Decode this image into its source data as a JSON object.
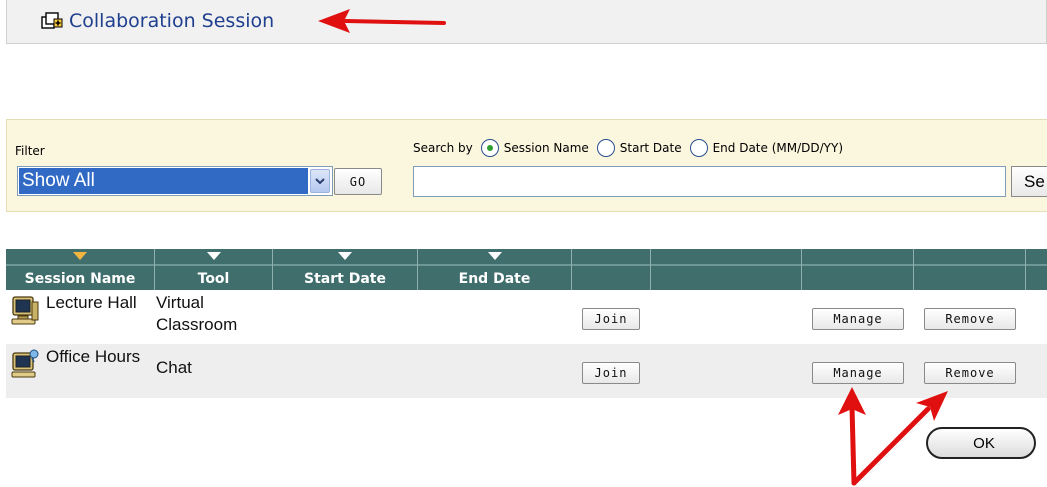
{
  "action_bar": {
    "link_label": "Collaboration Session",
    "icon": "add-session-icon"
  },
  "filter": {
    "label": "Filter",
    "selected": "Show All",
    "go_label": "GO"
  },
  "search": {
    "by_label": "Search by",
    "options": [
      {
        "label": "Session Name",
        "checked": true
      },
      {
        "label": "Start Date",
        "checked": false
      },
      {
        "label": "End Date (MM/DD/YY)",
        "checked": false
      }
    ],
    "value": "",
    "button_label": "Se"
  },
  "table": {
    "columns": [
      "Session Name",
      "Tool",
      "Start Date",
      "End Date",
      "",
      "",
      "",
      ""
    ],
    "rows": [
      {
        "icon": "computer-session-icon",
        "session_name": "Lecture Hall",
        "tool": "Virtual Classroom",
        "start_date": "",
        "end_date": "",
        "join_label": "Join",
        "manage_label": "Manage",
        "remove_label": "Remove"
      },
      {
        "icon": "computer-chat-icon",
        "session_name": "Office Hours",
        "tool": "Chat",
        "start_date": "",
        "end_date": "",
        "join_label": "Join",
        "manage_label": "Manage",
        "remove_label": "Remove"
      }
    ]
  },
  "ok_label": "OK",
  "colors": {
    "header_bg": "#3f6e6c",
    "filter_bg": "#fbf6de",
    "link_color": "#1f3f8f",
    "annotation_arrow": "#e01010",
    "active_sort": "#f2b640"
  }
}
